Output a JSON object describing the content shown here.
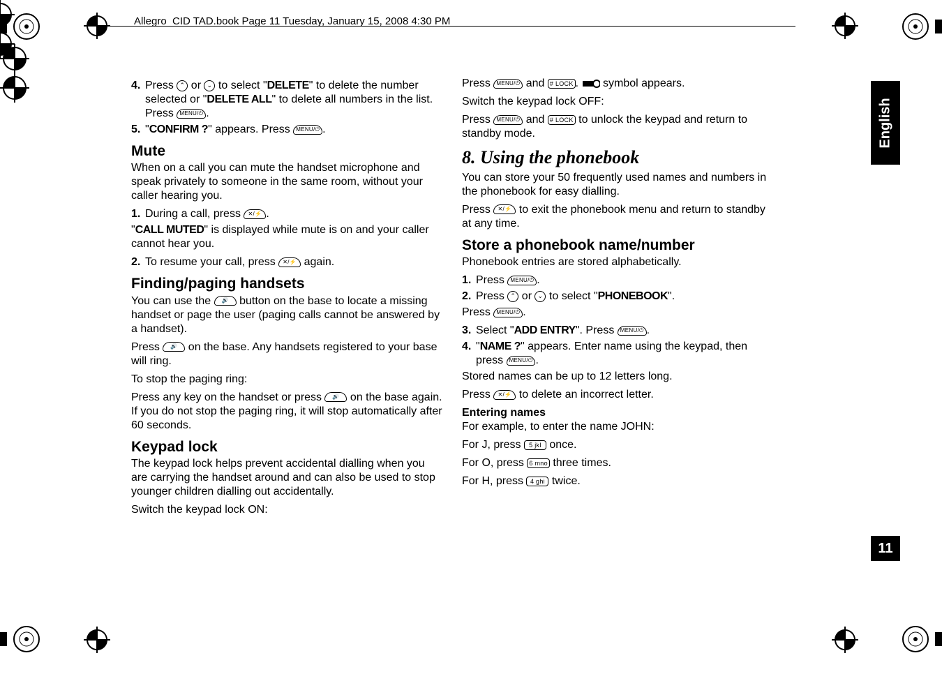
{
  "header": "Allegro_CID TAD.book  Page 11  Tuesday, January 15, 2008  4:30 PM",
  "side_lang": "English",
  "page_number": "11",
  "keys": {
    "menu": "MENU/⏻",
    "up": "⌃",
    "down": "⌄",
    "x": "✕/⚡",
    "spk": "🔊",
    "hash": "# LOCK",
    "k4": "4 ghi",
    "k5": "5 jkl",
    "k6": "6 mno"
  },
  "left": {
    "s4_a": "Press ",
    "s4_b": " or ",
    "s4_c": " to select \"",
    "s4_d": "DELETE",
    "s4_e": "\" to delete the number selected or \"",
    "s4_f": "DELETE ALL",
    "s4_g": "\" to delete all numbers in the list. Press ",
    "s4_h": ".",
    "s5_a": "\"",
    "s5_b": "CONFIRM ?",
    "s5_c": "\" appears. Press ",
    "s5_d": ".",
    "mute_h": "Mute",
    "mute_p": "When on a call you can mute the handset microphone and speak privately to someone in the same room, without your caller hearing you.",
    "m1_a": "During a call, press ",
    "m1_b": ".",
    "m_p2a": "\"",
    "m_p2b": "CALL MUTED",
    "m_p2c": "\" is displayed while mute is on and your caller cannot hear you.",
    "m2_a": "To resume your call, press ",
    "m2_b": " again.",
    "find_h": "Finding/paging handsets",
    "find_p1a": "You can use the ",
    "find_p1b": " button on the base to locate a missing handset or page the user (paging calls cannot be answered by a handset).",
    "find_p2a": "Press ",
    "find_p2b": " on the base. Any handsets registered to your base will ring.",
    "find_p3": "To stop the paging ring:",
    "find_p4a": "Press any key on the handset or press ",
    "find_p4b": " on the base again. If you do not stop the paging ring, it will stop automatically after 60 seconds.",
    "key_h": "Keypad lock",
    "key_p1": "The keypad lock helps prevent accidental dialling when you are carrying the handset around and can also be used to stop younger children dialling out accidentally.",
    "key_p2": "Switch the keypad lock ON:",
    "n4": "4.",
    "n5": "5.",
    "n1": "1.",
    "n2": "2."
  },
  "right": {
    "r1a": "Press ",
    "r1b": " and ",
    "r1c": ". ",
    "r1d": " symbol appears.",
    "r2": "Switch the keypad lock OFF:",
    "r3a": "Press ",
    "r3b": " and ",
    "r3c": " to unlock the keypad and return to standby mode.",
    "h8": "8. Using the phonebook",
    "h8_p": "You can store your 50 frequently used names and numbers in the phonebook for easy dialling.",
    "h8_p2a": "Press ",
    "h8_p2b": " to exit the phonebook menu and return to standby at any time.",
    "store_h": "Store a phonebook name/number",
    "store_p": "Phonebook entries are stored alphabetically.",
    "st1a": "Press ",
    "st1b": ".",
    "st2a": "Press ",
    "st2b": " or ",
    "st2c": " to select \"",
    "st2d": "PHONEBOOK",
    "st2e": "\".",
    "pr_a": "Press ",
    "pr_b": ".",
    "st3a": "Select \"",
    "st3b": "ADD ENTRY",
    "st3c": "\". Press ",
    "st3d": ".",
    "st4a": "\"",
    "st4b": "NAME ?",
    "st4c": "\" appears. Enter name using the keypad, then press ",
    "st4d": ".",
    "stored": "Stored names can be up to 12 letters long.",
    "del_a": "Press ",
    "del_b": " to delete an incorrect letter.",
    "en_h": "Entering names",
    "en_p": "For example, to enter the name JOHN:",
    "j_a": "For J, press ",
    "j_b": " once.",
    "o_a": "For O, press ",
    "o_b": " three times.",
    "hh_a": "For H, press ",
    "hh_b": " twice.",
    "n1": "1.",
    "n2": "2.",
    "n3": "3.",
    "n4": "4."
  }
}
